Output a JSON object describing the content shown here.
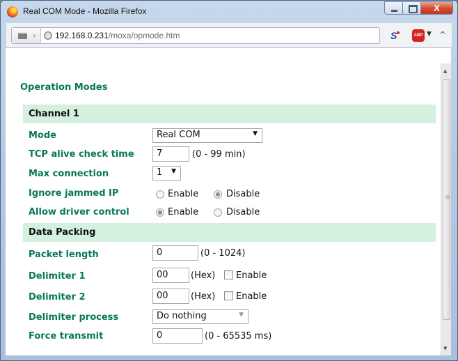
{
  "window": {
    "title": "Real COM Mode - Mozilla Firefox",
    "close_label": "X"
  },
  "navbar": {
    "url_host": "192.168.0.231",
    "url_path": "/moxa/opmode.htm",
    "s_icon": "S",
    "abp_label": "ABP"
  },
  "page": {
    "title": "Operation Modes"
  },
  "channel": {
    "header": "Channel 1",
    "mode_label": "Mode",
    "mode_value": "Real COM",
    "tcp_label": "TCP alive check time",
    "tcp_value": "7",
    "tcp_range": "(0 - 99 min)",
    "maxconn_label": "Max connection",
    "maxconn_value": "1",
    "ignore_label": "Ignore jammed IP",
    "ignore_enable": "Enable",
    "ignore_disable": "Disable",
    "ignore_selected": "Disable",
    "driver_label": "Allow driver control",
    "driver_enable": "Enable",
    "driver_disable": "Disable",
    "driver_selected": "Enable"
  },
  "packing": {
    "header": "Data Packing",
    "packet_label": "Packet length",
    "packet_value": "0",
    "packet_range": "(0 - 1024)",
    "delim1_label": "Delimiter 1",
    "delim1_value": "00",
    "delim1_hex": "(Hex)",
    "delim1_enable": "Enable",
    "delim2_label": "Delimiter 2",
    "delim2_value": "00",
    "delim2_hex": "(Hex)",
    "delim2_enable": "Enable",
    "process_label": "Delimiter process",
    "process_value": "Do nothing",
    "force_label": "Force transmit",
    "force_value": "0",
    "force_range": "(0 - 65535 ms)"
  }
}
